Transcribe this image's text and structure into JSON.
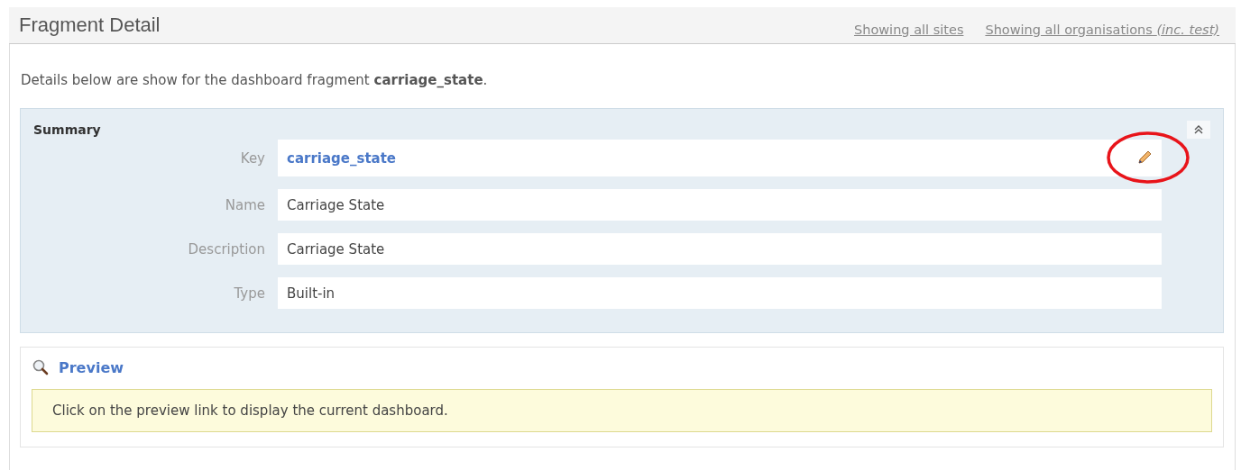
{
  "header": {
    "title": "Fragment Detail",
    "links": [
      "Showing all sites",
      "Showing all organisations *(inc. test)*"
    ]
  },
  "intro": "Details below are show for the dashboard fragment **carriage_state**.",
  "summary": {
    "title": "Summary",
    "expanded": true,
    "fields": [
      {
        "label": "Key",
        "value": "carriage_state",
        "kind": "link"
      },
      {
        "label": "Name",
        "value": "Carriage State",
        "kind": "text"
      },
      {
        "label": "Description",
        "value": "Carriage State",
        "kind": "text"
      },
      {
        "label": "Type",
        "value": "Built-in",
        "kind": "text"
      }
    ]
  },
  "preview": {
    "title": "Preview",
    "message": "Click on the preview link to display the current dashboard."
  }
}
